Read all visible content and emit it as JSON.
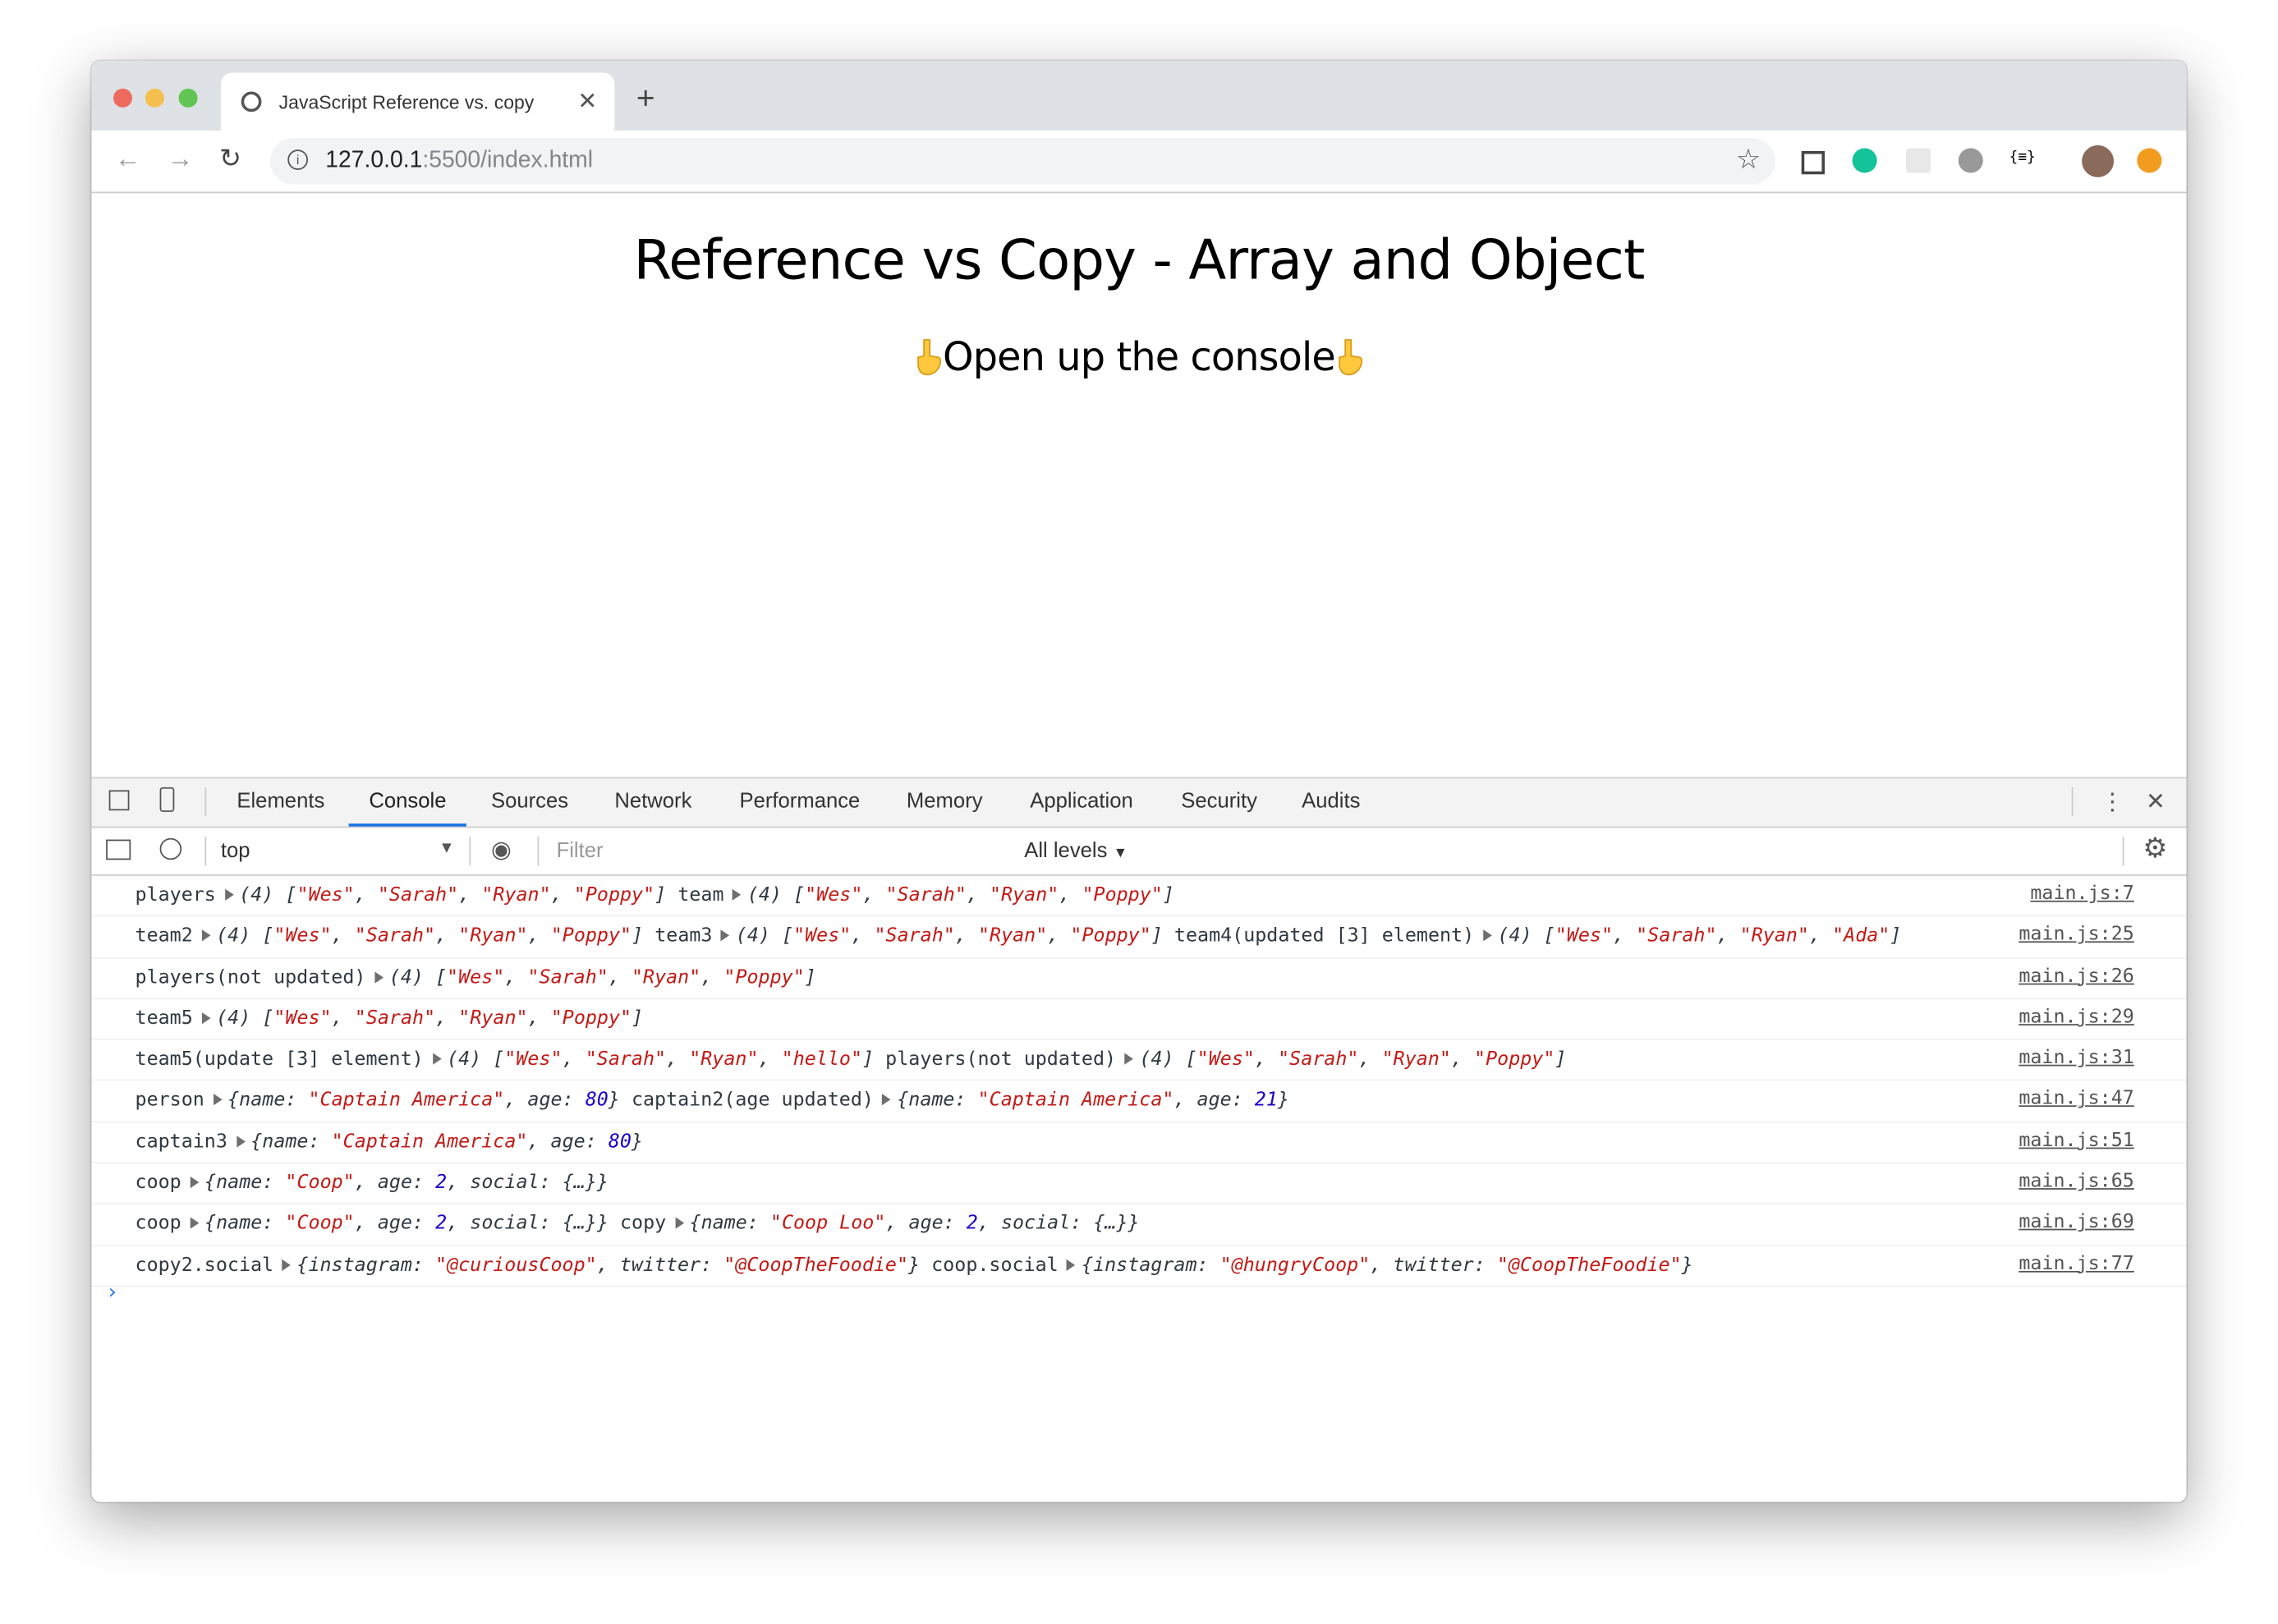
{
  "browser": {
    "tab_title": "JavaScript Reference vs. copy",
    "url_host": "127.0.0.1",
    "url_rest": ":5500/index.html",
    "traffic_colors": [
      "#ed6a5e",
      "#f5bf4f",
      "#61c554"
    ]
  },
  "page": {
    "title": "Reference vs Copy - Array and Object",
    "subtitle": "Open up the console",
    "emoji": "👇"
  },
  "devtools": {
    "tabs": [
      "Elements",
      "Console",
      "Sources",
      "Network",
      "Performance",
      "Memory",
      "Application",
      "Security",
      "Audits"
    ],
    "active_tab": "Console",
    "context": "top",
    "filter_placeholder": "Filter",
    "levels": "All levels",
    "prompt": "›"
  },
  "console": [
    {
      "src": "main.js:7",
      "parts": [
        {
          "label": "players",
          "kind": "array",
          "count": 4,
          "items": [
            "Wes",
            "Sarah",
            "Ryan",
            "Poppy"
          ]
        },
        {
          "label": "team",
          "kind": "array",
          "count": 4,
          "items": [
            "Wes",
            "Sarah",
            "Ryan",
            "Poppy"
          ]
        }
      ]
    },
    {
      "src": "main.js:25",
      "parts": [
        {
          "label": "team2",
          "kind": "array",
          "count": 4,
          "items": [
            "Wes",
            "Sarah",
            "Ryan",
            "Poppy"
          ]
        },
        {
          "label": "team3",
          "kind": "array",
          "count": 4,
          "items": [
            "Wes",
            "Sarah",
            "Ryan",
            "Poppy"
          ]
        },
        {
          "label": "team4(updated [3] element)",
          "kind": "array",
          "count": 4,
          "items": [
            "Wes",
            "Sarah",
            "Ryan",
            "Ada"
          ]
        }
      ]
    },
    {
      "src": "main.js:26",
      "parts": [
        {
          "label": "players(not updated)",
          "kind": "array",
          "count": 4,
          "items": [
            "Wes",
            "Sarah",
            "Ryan",
            "Poppy"
          ]
        }
      ]
    },
    {
      "src": "main.js:29",
      "parts": [
        {
          "label": "team5",
          "kind": "array",
          "count": 4,
          "items": [
            "Wes",
            "Sarah",
            "Ryan",
            "Poppy"
          ]
        }
      ]
    },
    {
      "src": "main.js:31",
      "parts": [
        {
          "label": "team5(update [3] element)",
          "kind": "array",
          "count": 4,
          "items": [
            "Wes",
            "Sarah",
            "Ryan",
            "hello"
          ]
        },
        {
          "label": "players(not updated)",
          "kind": "array",
          "count": 4,
          "items": [
            "Wes",
            "Sarah",
            "Ryan",
            "Poppy"
          ]
        }
      ]
    },
    {
      "src": "main.js:47",
      "parts": [
        {
          "label": "person",
          "kind": "object",
          "props": [
            {
              "k": "name",
              "v": "Captain America",
              "t": "s"
            },
            {
              "k": "age",
              "v": "80",
              "t": "n"
            }
          ]
        },
        {
          "label": "captain2(age updated)",
          "kind": "object",
          "props": [
            {
              "k": "name",
              "v": "Captain America",
              "t": "s"
            },
            {
              "k": "age",
              "v": "21",
              "t": "n"
            }
          ]
        }
      ]
    },
    {
      "src": "main.js:51",
      "parts": [
        {
          "label": "captain3",
          "kind": "object",
          "props": [
            {
              "k": "name",
              "v": "Captain America",
              "t": "s"
            },
            {
              "k": "age",
              "v": "80",
              "t": "n"
            }
          ]
        }
      ]
    },
    {
      "src": "main.js:65",
      "parts": [
        {
          "label": "coop",
          "kind": "object",
          "props": [
            {
              "k": "name",
              "v": "Coop",
              "t": "s"
            },
            {
              "k": "age",
              "v": "2",
              "t": "n"
            },
            {
              "k": "social",
              "v": "{…}",
              "t": "o"
            }
          ]
        }
      ]
    },
    {
      "src": "main.js:69",
      "parts": [
        {
          "label": "coop",
          "kind": "object",
          "props": [
            {
              "k": "name",
              "v": "Coop",
              "t": "s"
            },
            {
              "k": "age",
              "v": "2",
              "t": "n"
            },
            {
              "k": "social",
              "v": "{…}",
              "t": "o"
            }
          ]
        },
        {
          "label": "copy",
          "kind": "object",
          "props": [
            {
              "k": "name",
              "v": "Coop Loo",
              "t": "s"
            },
            {
              "k": "age",
              "v": "2",
              "t": "n"
            },
            {
              "k": "social",
              "v": "{…}",
              "t": "o"
            }
          ]
        }
      ]
    },
    {
      "src": "main.js:77",
      "parts": [
        {
          "label": "copy2.social",
          "kind": "object",
          "props": [
            {
              "k": "instagram",
              "v": "@curiousCoop",
              "t": "s"
            },
            {
              "k": "twitter",
              "v": "@CoopTheFoodie",
              "t": "s"
            }
          ]
        },
        {
          "label": "coop.social",
          "kind": "object",
          "props": [
            {
              "k": "instagram",
              "v": "@hungryCoop",
              "t": "s"
            },
            {
              "k": "twitter",
              "v": "@CoopTheFoodie",
              "t": "s"
            }
          ]
        }
      ]
    }
  ]
}
